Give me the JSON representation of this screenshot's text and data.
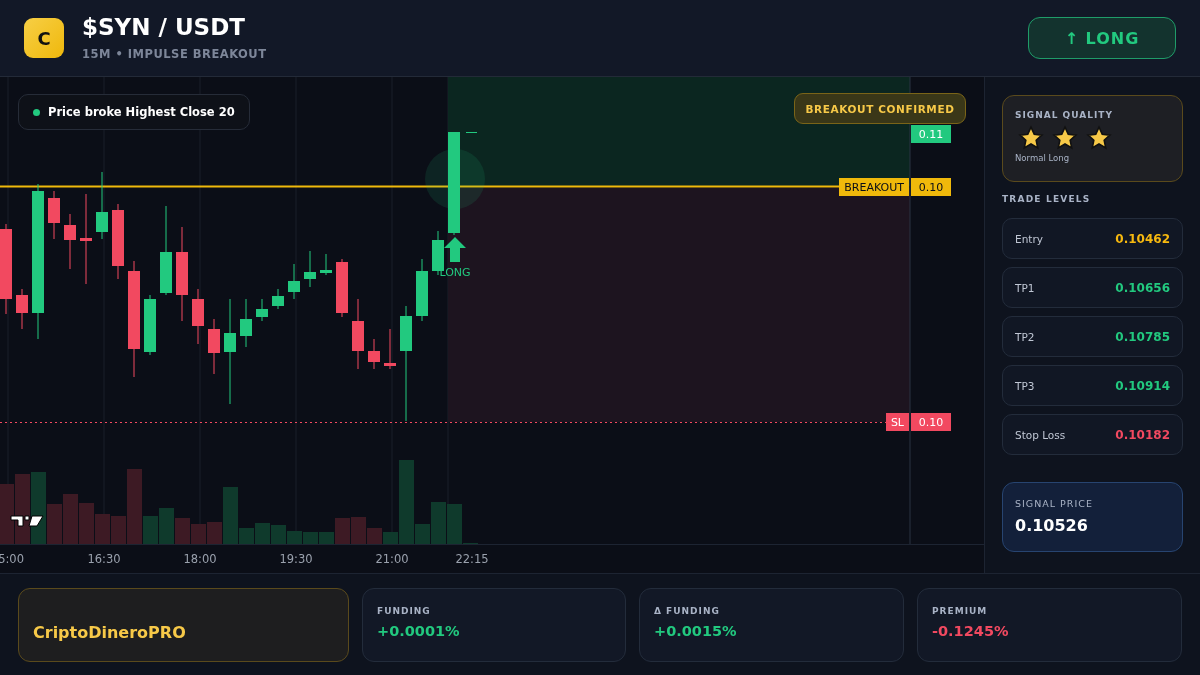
{
  "header": {
    "logo_letter": "C",
    "pair": "$SYN / USDT",
    "subtitle": "15M • IMPULSE BREAKOUT",
    "direction_button": {
      "arrow": "↑",
      "label": "LONG"
    }
  },
  "chart": {
    "condition_badge": "Price broke Highest Close 20",
    "status_badge": "BREAKOUT CONFIRMED",
    "signal_marker_label": "LONG",
    "price_labels": [
      {
        "kind": "target",
        "value": "0.11"
      },
      {
        "kind": "breakout",
        "tag": "BREAKOUT",
        "value": "0.10"
      },
      {
        "kind": "stop",
        "tag": "SL",
        "value": "0.10"
      }
    ],
    "time_labels": [
      "5:00",
      "16:30",
      "18:00",
      "19:30",
      "21:00",
      "22:15"
    ]
  },
  "sidebar": {
    "signal_quality": {
      "title": "SIGNAL QUALITY",
      "stars": 3,
      "label": "Normal Long"
    },
    "trade_levels": {
      "title": "TRADE LEVELS",
      "rows": [
        {
          "kind": "entry",
          "label": "Entry",
          "value": "0.10462"
        },
        {
          "kind": "target",
          "label": "TP1",
          "value": "0.10656"
        },
        {
          "kind": "target",
          "label": "TP2",
          "value": "0.10785"
        },
        {
          "kind": "target",
          "label": "TP3",
          "value": "0.10914"
        },
        {
          "kind": "stop",
          "label": "Stop Loss",
          "value": "0.10182"
        }
      ]
    },
    "signal_price": {
      "label": "SIGNAL PRICE",
      "value": "0.10526"
    }
  },
  "footer": {
    "brand": "CriptoDineroPRO",
    "stats": [
      {
        "kind": "positive",
        "label": "FUNDING",
        "value": "+0.0001%"
      },
      {
        "kind": "positive",
        "label": "Δ FUNDING",
        "value": "+0.0015%"
      },
      {
        "kind": "negative",
        "label": "PREMIUM",
        "value": "-0.1245%"
      }
    ]
  }
}
